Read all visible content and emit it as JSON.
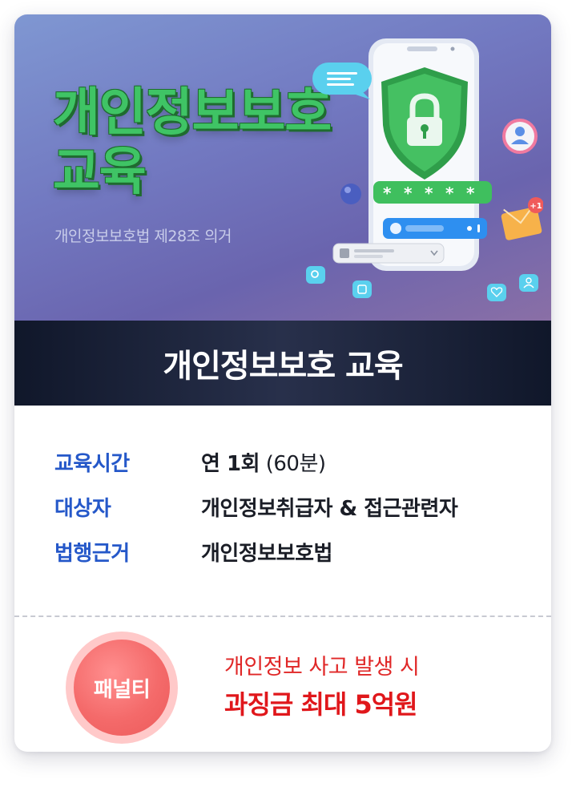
{
  "hero": {
    "title_line1": "개인정보보호",
    "title_line2": "교육",
    "subtitle": "개인정보보호법 제28조 의거",
    "notification_count": "+1"
  },
  "band": {
    "title": "개인정보보호 교육"
  },
  "info": {
    "rows": [
      {
        "label": "교육시간",
        "value_strong": "연 1회",
        "value_light": " (60분)"
      },
      {
        "label": "대상자",
        "value_strong": "개인정보취급자 & 접근관련자",
        "value_light": ""
      },
      {
        "label": "법행근거",
        "value_strong": "개인정보보호법",
        "value_light": ""
      }
    ]
  },
  "penalty": {
    "badge": "패널티",
    "line1": "개인정보 사고 발생 시",
    "line2": "과징금 최대 5억원"
  },
  "colors": {
    "title_green": "#3fc465",
    "label_blue": "#2558c9",
    "penalty_red": "#e0171b",
    "band_dark": "#10172a"
  }
}
